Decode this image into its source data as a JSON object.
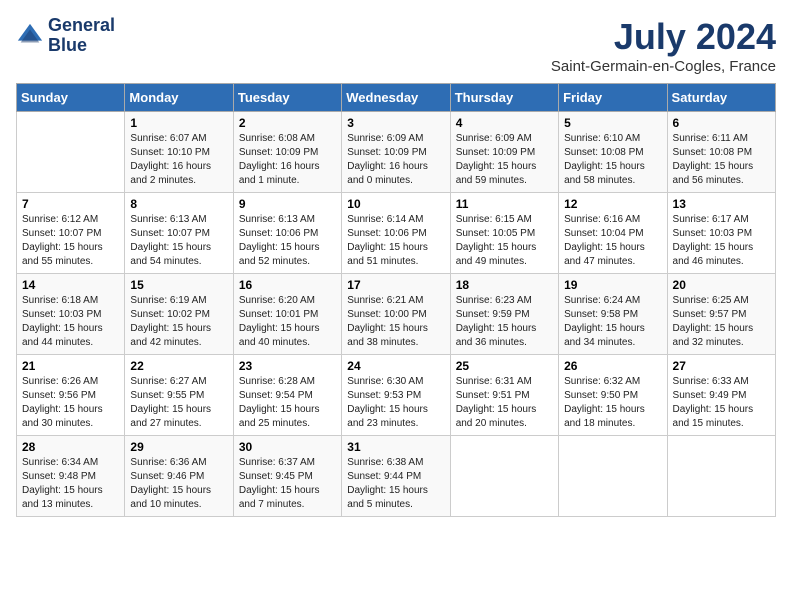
{
  "header": {
    "logo_line1": "General",
    "logo_line2": "Blue",
    "month_year": "July 2024",
    "location": "Saint-Germain-en-Cogles, France"
  },
  "weekdays": [
    "Sunday",
    "Monday",
    "Tuesday",
    "Wednesday",
    "Thursday",
    "Friday",
    "Saturday"
  ],
  "weeks": [
    [
      {
        "date": "",
        "info": ""
      },
      {
        "date": "1",
        "info": "Sunrise: 6:07 AM\nSunset: 10:10 PM\nDaylight: 16 hours\nand 2 minutes."
      },
      {
        "date": "2",
        "info": "Sunrise: 6:08 AM\nSunset: 10:09 PM\nDaylight: 16 hours\nand 1 minute."
      },
      {
        "date": "3",
        "info": "Sunrise: 6:09 AM\nSunset: 10:09 PM\nDaylight: 16 hours\nand 0 minutes."
      },
      {
        "date": "4",
        "info": "Sunrise: 6:09 AM\nSunset: 10:09 PM\nDaylight: 15 hours\nand 59 minutes."
      },
      {
        "date": "5",
        "info": "Sunrise: 6:10 AM\nSunset: 10:08 PM\nDaylight: 15 hours\nand 58 minutes."
      },
      {
        "date": "6",
        "info": "Sunrise: 6:11 AM\nSunset: 10:08 PM\nDaylight: 15 hours\nand 56 minutes."
      }
    ],
    [
      {
        "date": "7",
        "info": "Sunrise: 6:12 AM\nSunset: 10:07 PM\nDaylight: 15 hours\nand 55 minutes."
      },
      {
        "date": "8",
        "info": "Sunrise: 6:13 AM\nSunset: 10:07 PM\nDaylight: 15 hours\nand 54 minutes."
      },
      {
        "date": "9",
        "info": "Sunrise: 6:13 AM\nSunset: 10:06 PM\nDaylight: 15 hours\nand 52 minutes."
      },
      {
        "date": "10",
        "info": "Sunrise: 6:14 AM\nSunset: 10:06 PM\nDaylight: 15 hours\nand 51 minutes."
      },
      {
        "date": "11",
        "info": "Sunrise: 6:15 AM\nSunset: 10:05 PM\nDaylight: 15 hours\nand 49 minutes."
      },
      {
        "date": "12",
        "info": "Sunrise: 6:16 AM\nSunset: 10:04 PM\nDaylight: 15 hours\nand 47 minutes."
      },
      {
        "date": "13",
        "info": "Sunrise: 6:17 AM\nSunset: 10:03 PM\nDaylight: 15 hours\nand 46 minutes."
      }
    ],
    [
      {
        "date": "14",
        "info": "Sunrise: 6:18 AM\nSunset: 10:03 PM\nDaylight: 15 hours\nand 44 minutes."
      },
      {
        "date": "15",
        "info": "Sunrise: 6:19 AM\nSunset: 10:02 PM\nDaylight: 15 hours\nand 42 minutes."
      },
      {
        "date": "16",
        "info": "Sunrise: 6:20 AM\nSunset: 10:01 PM\nDaylight: 15 hours\nand 40 minutes."
      },
      {
        "date": "17",
        "info": "Sunrise: 6:21 AM\nSunset: 10:00 PM\nDaylight: 15 hours\nand 38 minutes."
      },
      {
        "date": "18",
        "info": "Sunrise: 6:23 AM\nSunset: 9:59 PM\nDaylight: 15 hours\nand 36 minutes."
      },
      {
        "date": "19",
        "info": "Sunrise: 6:24 AM\nSunset: 9:58 PM\nDaylight: 15 hours\nand 34 minutes."
      },
      {
        "date": "20",
        "info": "Sunrise: 6:25 AM\nSunset: 9:57 PM\nDaylight: 15 hours\nand 32 minutes."
      }
    ],
    [
      {
        "date": "21",
        "info": "Sunrise: 6:26 AM\nSunset: 9:56 PM\nDaylight: 15 hours\nand 30 minutes."
      },
      {
        "date": "22",
        "info": "Sunrise: 6:27 AM\nSunset: 9:55 PM\nDaylight: 15 hours\nand 27 minutes."
      },
      {
        "date": "23",
        "info": "Sunrise: 6:28 AM\nSunset: 9:54 PM\nDaylight: 15 hours\nand 25 minutes."
      },
      {
        "date": "24",
        "info": "Sunrise: 6:30 AM\nSunset: 9:53 PM\nDaylight: 15 hours\nand 23 minutes."
      },
      {
        "date": "25",
        "info": "Sunrise: 6:31 AM\nSunset: 9:51 PM\nDaylight: 15 hours\nand 20 minutes."
      },
      {
        "date": "26",
        "info": "Sunrise: 6:32 AM\nSunset: 9:50 PM\nDaylight: 15 hours\nand 18 minutes."
      },
      {
        "date": "27",
        "info": "Sunrise: 6:33 AM\nSunset: 9:49 PM\nDaylight: 15 hours\nand 15 minutes."
      }
    ],
    [
      {
        "date": "28",
        "info": "Sunrise: 6:34 AM\nSunset: 9:48 PM\nDaylight: 15 hours\nand 13 minutes."
      },
      {
        "date": "29",
        "info": "Sunrise: 6:36 AM\nSunset: 9:46 PM\nDaylight: 15 hours\nand 10 minutes."
      },
      {
        "date": "30",
        "info": "Sunrise: 6:37 AM\nSunset: 9:45 PM\nDaylight: 15 hours\nand 7 minutes."
      },
      {
        "date": "31",
        "info": "Sunrise: 6:38 AM\nSunset: 9:44 PM\nDaylight: 15 hours\nand 5 minutes."
      },
      {
        "date": "",
        "info": ""
      },
      {
        "date": "",
        "info": ""
      },
      {
        "date": "",
        "info": ""
      }
    ]
  ]
}
